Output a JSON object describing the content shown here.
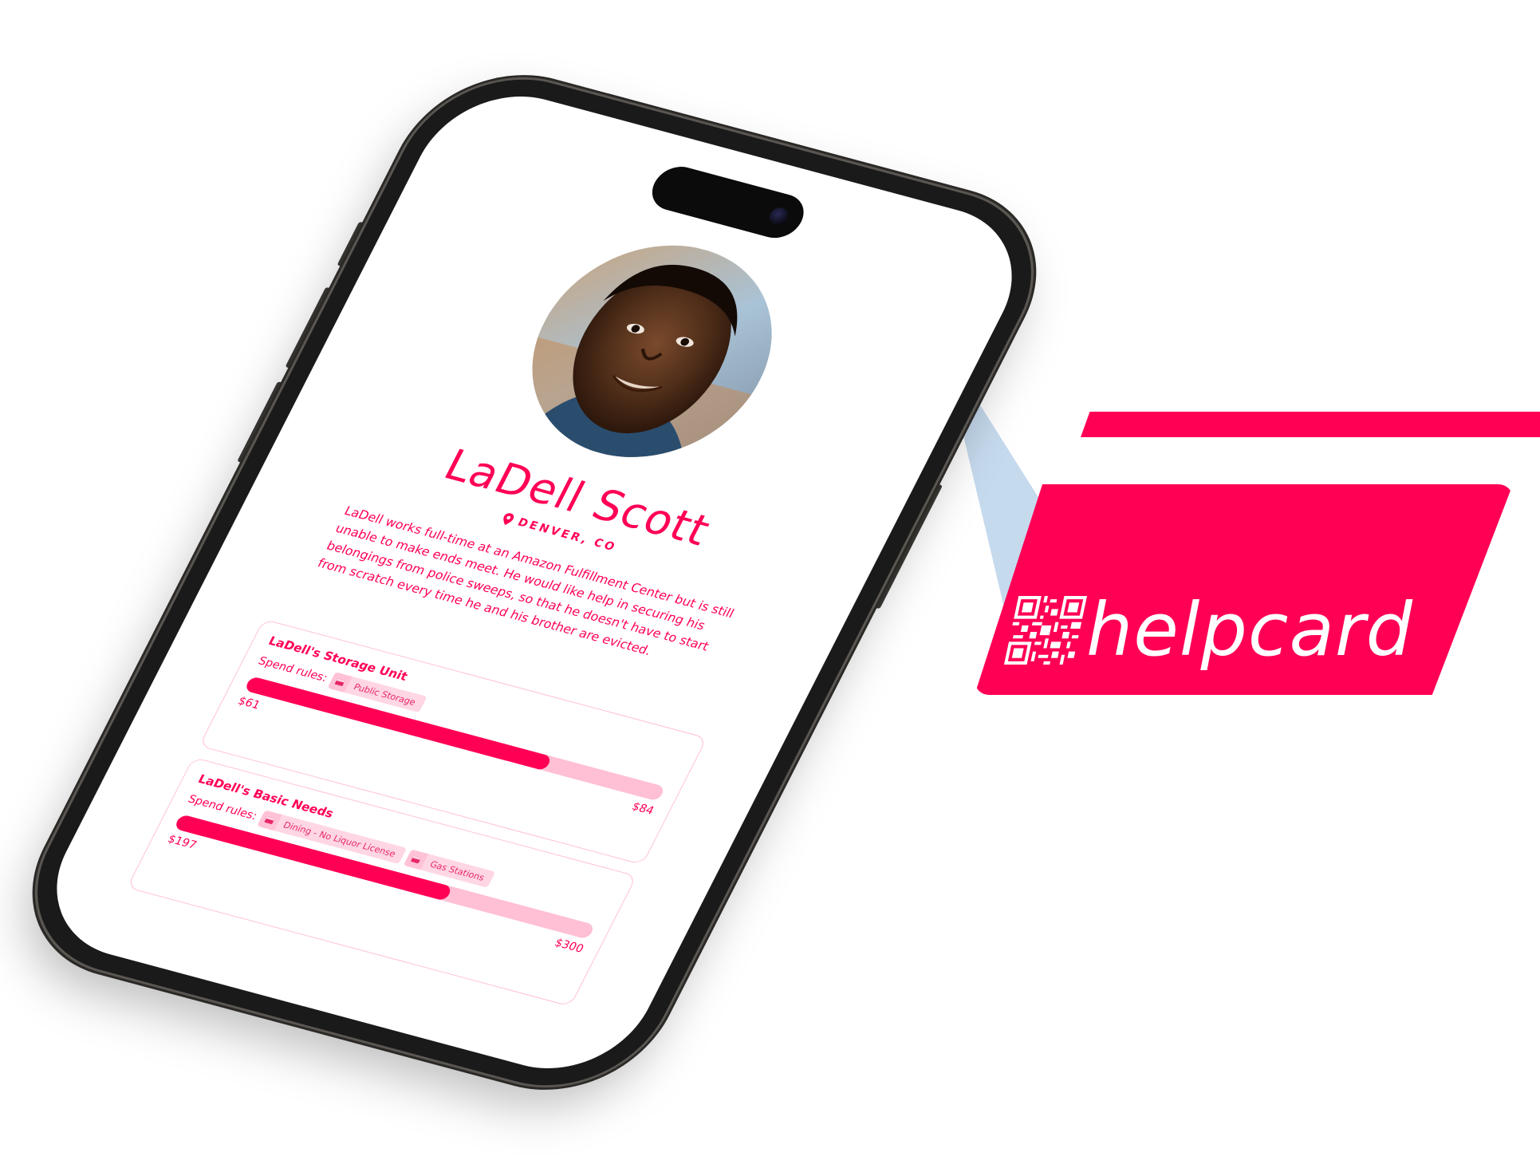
{
  "profile": {
    "name": "LaDell Scott",
    "location": "DENVER, CO",
    "bio": "LaDell works full-time at an Amazon Fulfillment Center but is still unable to make ends meet. He would like help in securing his belongings from police sweeps, so that he doesn't have to start from scratch every time he and his brother are evicted.",
    "avatar_icon": "portrait-photo"
  },
  "funds": [
    {
      "title": "LaDell's Storage Unit",
      "spend_rules_label": "Spend rules:",
      "rules": [
        {
          "icon": "storefront-icon",
          "label": "Public Storage"
        }
      ],
      "raised": "$61",
      "goal": "$84",
      "progress_fraction": 0.726
    },
    {
      "title": "LaDell's Basic Needs",
      "spend_rules_label": "Spend rules:",
      "rules": [
        {
          "icon": "storefront-icon",
          "label": "Dining - No Liquor License"
        },
        {
          "icon": "storefront-icon",
          "label": "Gas Stations"
        }
      ],
      "raised": "$197",
      "goal": "$300",
      "progress_fraction": 0.657
    }
  ],
  "card": {
    "brand": "helpcard",
    "qr_icon": "qr-code-icon"
  },
  "colors": {
    "brand": "#ff0055",
    "track": "#ffbfd4",
    "beam": "#b6cfe9"
  }
}
